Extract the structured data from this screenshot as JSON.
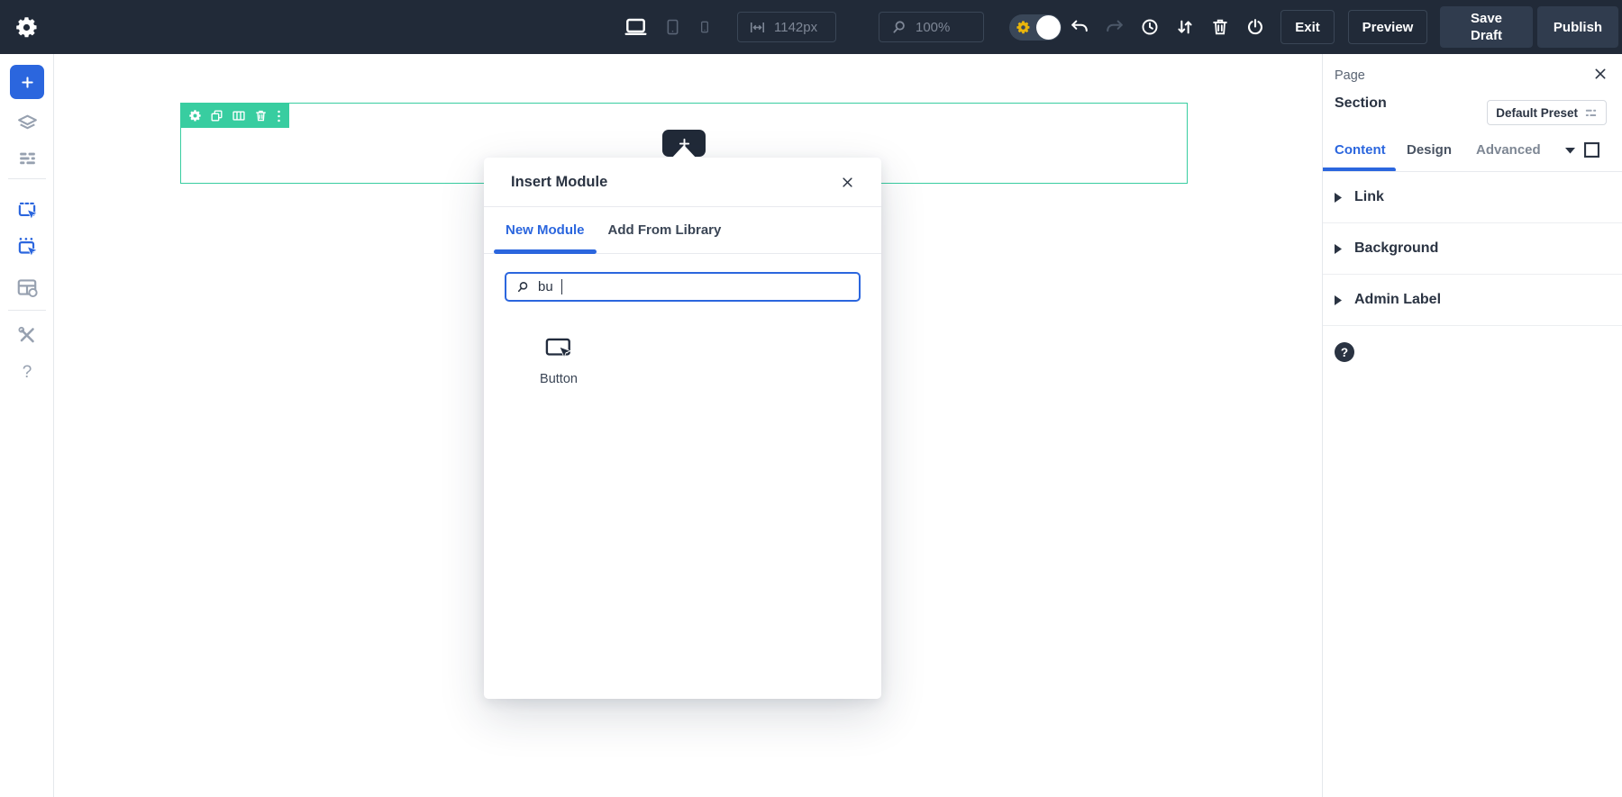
{
  "colors": {
    "topbar_bg": "#212A38",
    "accent_blue": "#2B66DE",
    "section_green": "#38CDA0",
    "dark_text": "#2A3342",
    "toggle_gear_gold": "#E9B50B"
  },
  "top_bar": {
    "responsive_width_value": "1142px",
    "zoom_value": "100%",
    "buttons": {
      "exit": "Exit",
      "preview": "Preview",
      "save_draft": "Save Draft",
      "publish": "Publish"
    },
    "icons": [
      "settings-gear",
      "desktop",
      "tablet",
      "phone",
      "responsive-width",
      "zoom-search",
      "builder-mode-toggle",
      "undo",
      "redo",
      "history-clock",
      "sort-arrows",
      "trash",
      "power"
    ]
  },
  "sidebar": {
    "help_label": "?",
    "icons": [
      "add-plus",
      "layers",
      "wireframe-view",
      "insert-module",
      "insert-row",
      "layout-settings",
      "tools"
    ]
  },
  "canvas": {
    "section_toolbar_icons": [
      "settings-gear",
      "duplicate",
      "columns",
      "trash",
      "options-menu"
    ]
  },
  "modal": {
    "title": "Insert Module",
    "tabs": [
      {
        "label": "New Module",
        "active": true
      },
      {
        "label": "Add From Library",
        "active": false
      }
    ],
    "search_value": "bu",
    "results": [
      {
        "label": "Button",
        "icon": "button-module-icon"
      }
    ]
  },
  "right_panel": {
    "title": "Page",
    "element_type": "Section",
    "preset_button_label": "Default Preset",
    "tabs": [
      {
        "label": "Content",
        "active": true
      },
      {
        "label": "Design",
        "active": false
      },
      {
        "label": "Advanced",
        "active": false
      }
    ],
    "accordions": [
      {
        "label": "Link"
      },
      {
        "label": "Background"
      },
      {
        "label": "Admin Label"
      }
    ],
    "help_label": "?"
  }
}
